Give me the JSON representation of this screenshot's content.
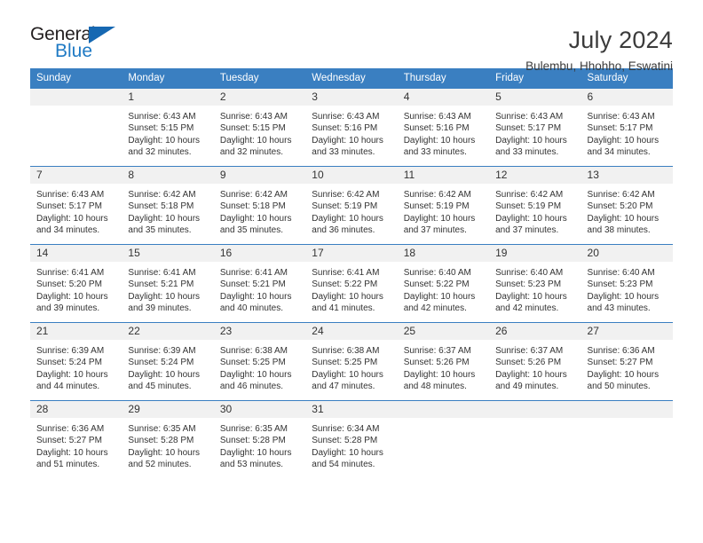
{
  "logo": {
    "word1": "General",
    "word2": "Blue",
    "triangle_color": "#1668b2",
    "blue_color": "#1f7ac4"
  },
  "header": {
    "title": "July 2024",
    "subtitle": "Bulembu, Hhohho, Eswatini"
  },
  "theme": {
    "header_bar": "#3a7fc1",
    "daynum_bg": "#f1f1f1",
    "text": "#333333"
  },
  "weekday_headers": [
    "Sunday",
    "Monday",
    "Tuesday",
    "Wednesday",
    "Thursday",
    "Friday",
    "Saturday"
  ],
  "labels": {
    "sunrise_prefix": "Sunrise: ",
    "sunset_prefix": "Sunset: ",
    "daylight_prefix": "Daylight: "
  },
  "weeks": [
    [
      {
        "day": "",
        "empty": true
      },
      {
        "day": "1",
        "sunrise": "Sunrise: 6:43 AM",
        "sunset": "Sunset: 5:15 PM",
        "daylight1": "Daylight: 10 hours",
        "daylight2": "and 32 minutes."
      },
      {
        "day": "2",
        "sunrise": "Sunrise: 6:43 AM",
        "sunset": "Sunset: 5:15 PM",
        "daylight1": "Daylight: 10 hours",
        "daylight2": "and 32 minutes."
      },
      {
        "day": "3",
        "sunrise": "Sunrise: 6:43 AM",
        "sunset": "Sunset: 5:16 PM",
        "daylight1": "Daylight: 10 hours",
        "daylight2": "and 33 minutes."
      },
      {
        "day": "4",
        "sunrise": "Sunrise: 6:43 AM",
        "sunset": "Sunset: 5:16 PM",
        "daylight1": "Daylight: 10 hours",
        "daylight2": "and 33 minutes."
      },
      {
        "day": "5",
        "sunrise": "Sunrise: 6:43 AM",
        "sunset": "Sunset: 5:17 PM",
        "daylight1": "Daylight: 10 hours",
        "daylight2": "and 33 minutes."
      },
      {
        "day": "6",
        "sunrise": "Sunrise: 6:43 AM",
        "sunset": "Sunset: 5:17 PM",
        "daylight1": "Daylight: 10 hours",
        "daylight2": "and 34 minutes."
      }
    ],
    [
      {
        "day": "7",
        "sunrise": "Sunrise: 6:43 AM",
        "sunset": "Sunset: 5:17 PM",
        "daylight1": "Daylight: 10 hours",
        "daylight2": "and 34 minutes."
      },
      {
        "day": "8",
        "sunrise": "Sunrise: 6:42 AM",
        "sunset": "Sunset: 5:18 PM",
        "daylight1": "Daylight: 10 hours",
        "daylight2": "and 35 minutes."
      },
      {
        "day": "9",
        "sunrise": "Sunrise: 6:42 AM",
        "sunset": "Sunset: 5:18 PM",
        "daylight1": "Daylight: 10 hours",
        "daylight2": "and 35 minutes."
      },
      {
        "day": "10",
        "sunrise": "Sunrise: 6:42 AM",
        "sunset": "Sunset: 5:19 PM",
        "daylight1": "Daylight: 10 hours",
        "daylight2": "and 36 minutes."
      },
      {
        "day": "11",
        "sunrise": "Sunrise: 6:42 AM",
        "sunset": "Sunset: 5:19 PM",
        "daylight1": "Daylight: 10 hours",
        "daylight2": "and 37 minutes."
      },
      {
        "day": "12",
        "sunrise": "Sunrise: 6:42 AM",
        "sunset": "Sunset: 5:19 PM",
        "daylight1": "Daylight: 10 hours",
        "daylight2": "and 37 minutes."
      },
      {
        "day": "13",
        "sunrise": "Sunrise: 6:42 AM",
        "sunset": "Sunset: 5:20 PM",
        "daylight1": "Daylight: 10 hours",
        "daylight2": "and 38 minutes."
      }
    ],
    [
      {
        "day": "14",
        "sunrise": "Sunrise: 6:41 AM",
        "sunset": "Sunset: 5:20 PM",
        "daylight1": "Daylight: 10 hours",
        "daylight2": "and 39 minutes."
      },
      {
        "day": "15",
        "sunrise": "Sunrise: 6:41 AM",
        "sunset": "Sunset: 5:21 PM",
        "daylight1": "Daylight: 10 hours",
        "daylight2": "and 39 minutes."
      },
      {
        "day": "16",
        "sunrise": "Sunrise: 6:41 AM",
        "sunset": "Sunset: 5:21 PM",
        "daylight1": "Daylight: 10 hours",
        "daylight2": "and 40 minutes."
      },
      {
        "day": "17",
        "sunrise": "Sunrise: 6:41 AM",
        "sunset": "Sunset: 5:22 PM",
        "daylight1": "Daylight: 10 hours",
        "daylight2": "and 41 minutes."
      },
      {
        "day": "18",
        "sunrise": "Sunrise: 6:40 AM",
        "sunset": "Sunset: 5:22 PM",
        "daylight1": "Daylight: 10 hours",
        "daylight2": "and 42 minutes."
      },
      {
        "day": "19",
        "sunrise": "Sunrise: 6:40 AM",
        "sunset": "Sunset: 5:23 PM",
        "daylight1": "Daylight: 10 hours",
        "daylight2": "and 42 minutes."
      },
      {
        "day": "20",
        "sunrise": "Sunrise: 6:40 AM",
        "sunset": "Sunset: 5:23 PM",
        "daylight1": "Daylight: 10 hours",
        "daylight2": "and 43 minutes."
      }
    ],
    [
      {
        "day": "21",
        "sunrise": "Sunrise: 6:39 AM",
        "sunset": "Sunset: 5:24 PM",
        "daylight1": "Daylight: 10 hours",
        "daylight2": "and 44 minutes."
      },
      {
        "day": "22",
        "sunrise": "Sunrise: 6:39 AM",
        "sunset": "Sunset: 5:24 PM",
        "daylight1": "Daylight: 10 hours",
        "daylight2": "and 45 minutes."
      },
      {
        "day": "23",
        "sunrise": "Sunrise: 6:38 AM",
        "sunset": "Sunset: 5:25 PM",
        "daylight1": "Daylight: 10 hours",
        "daylight2": "and 46 minutes."
      },
      {
        "day": "24",
        "sunrise": "Sunrise: 6:38 AM",
        "sunset": "Sunset: 5:25 PM",
        "daylight1": "Daylight: 10 hours",
        "daylight2": "and 47 minutes."
      },
      {
        "day": "25",
        "sunrise": "Sunrise: 6:37 AM",
        "sunset": "Sunset: 5:26 PM",
        "daylight1": "Daylight: 10 hours",
        "daylight2": "and 48 minutes."
      },
      {
        "day": "26",
        "sunrise": "Sunrise: 6:37 AM",
        "sunset": "Sunset: 5:26 PM",
        "daylight1": "Daylight: 10 hours",
        "daylight2": "and 49 minutes."
      },
      {
        "day": "27",
        "sunrise": "Sunrise: 6:36 AM",
        "sunset": "Sunset: 5:27 PM",
        "daylight1": "Daylight: 10 hours",
        "daylight2": "and 50 minutes."
      }
    ],
    [
      {
        "day": "28",
        "sunrise": "Sunrise: 6:36 AM",
        "sunset": "Sunset: 5:27 PM",
        "daylight1": "Daylight: 10 hours",
        "daylight2": "and 51 minutes."
      },
      {
        "day": "29",
        "sunrise": "Sunrise: 6:35 AM",
        "sunset": "Sunset: 5:28 PM",
        "daylight1": "Daylight: 10 hours",
        "daylight2": "and 52 minutes."
      },
      {
        "day": "30",
        "sunrise": "Sunrise: 6:35 AM",
        "sunset": "Sunset: 5:28 PM",
        "daylight1": "Daylight: 10 hours",
        "daylight2": "and 53 minutes."
      },
      {
        "day": "31",
        "sunrise": "Sunrise: 6:34 AM",
        "sunset": "Sunset: 5:28 PM",
        "daylight1": "Daylight: 10 hours",
        "daylight2": "and 54 minutes."
      },
      {
        "day": "",
        "empty": true
      },
      {
        "day": "",
        "empty": true
      },
      {
        "day": "",
        "empty": true
      }
    ]
  ]
}
